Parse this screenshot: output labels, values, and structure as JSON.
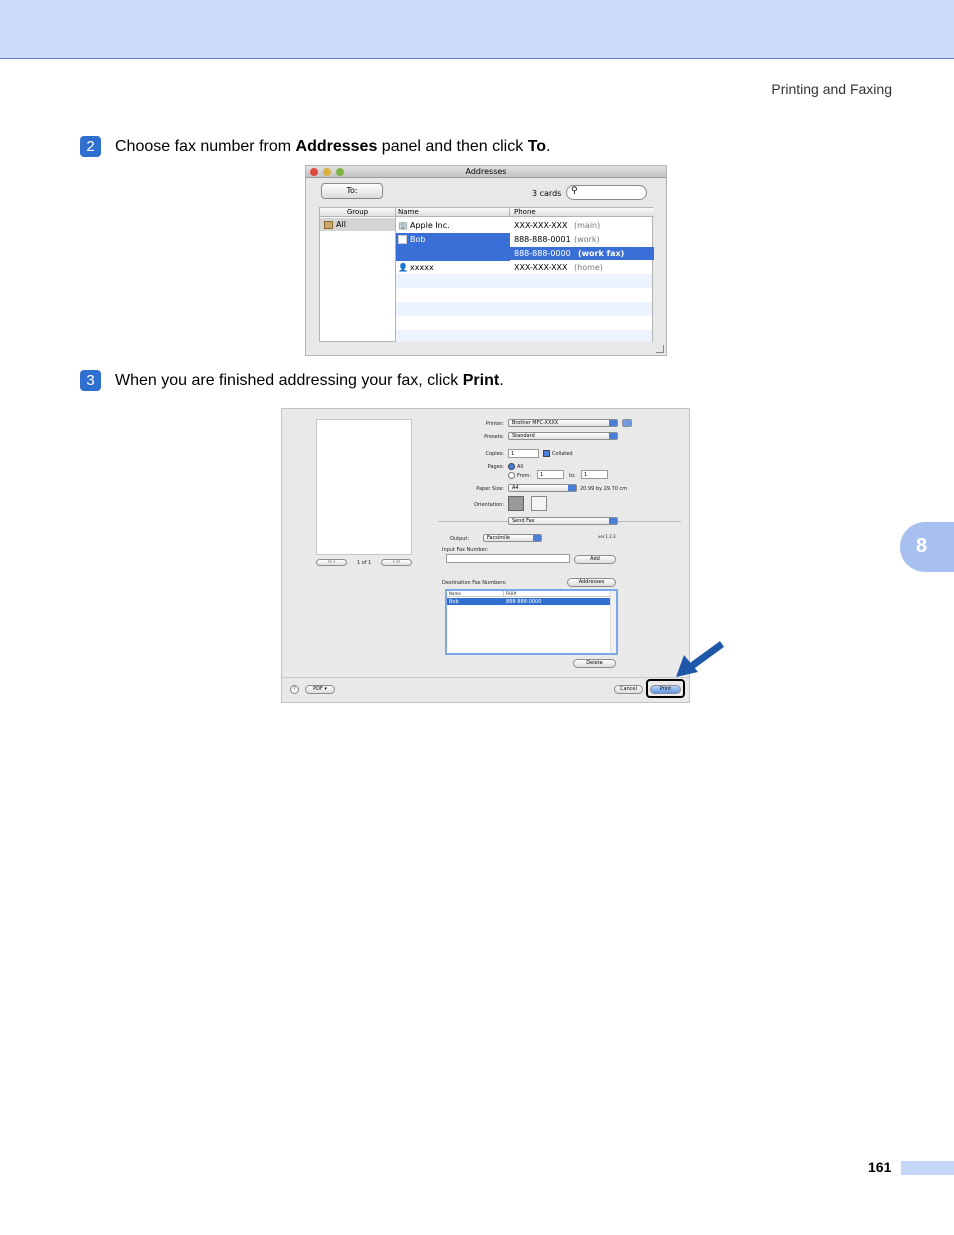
{
  "header": {
    "section_title": "Printing and Faxing"
  },
  "chapter_tab": "8",
  "steps": [
    {
      "number": "2",
      "pre": "Choose fax number from ",
      "bold1": "Addresses",
      "mid": " panel and then click ",
      "bold2": "To",
      "post": "."
    },
    {
      "number": "3",
      "pre": "When you are finished addressing your fax, click ",
      "bold1": "Print",
      "post": "."
    }
  ],
  "addresses_window": {
    "title": "Addresses",
    "to_button": "To:",
    "cards_count": "3 cards",
    "search_placeholder": "",
    "columns": {
      "group": "Group",
      "name": "Name",
      "phone": "Phone"
    },
    "groups": [
      "All"
    ],
    "entries": [
      {
        "name": "Apple Inc.",
        "phone": "XXX-XXX-XXX",
        "type": "(main)"
      },
      {
        "name": "Bob",
        "phone": "888-888-0001",
        "type": "(work)"
      },
      {
        "name": "",
        "phone": "888-888-0000",
        "type": "(work fax)"
      },
      {
        "name": "xxxxx",
        "phone": "XXX-XXX-XXX",
        "type": "(home)"
      }
    ]
  },
  "print_dialog": {
    "printer_label": "Printer:",
    "printer_value": "Brother MFC-XXXX",
    "presets_label": "Presets:",
    "presets_value": "Standard",
    "copies_label": "Copies:",
    "copies_value": "1",
    "collated": "Collated",
    "pages_label": "Pages:",
    "pages_all": "All",
    "pages_from": "From:",
    "from_value": "1",
    "pages_to": "to:",
    "to_value": "1",
    "paper_label": "Paper Size:",
    "paper_value": "A4",
    "paper_dims": "20.99 by 29.70 cm",
    "orientation_label": "Orientation:",
    "panel_value": "Send Fax",
    "output_label": "Output:",
    "output_value": "Facsimile",
    "version": "ver.1.2.3",
    "input_fax_label": "Input Fax Number:",
    "add_button": "Add",
    "dest_label": "Destination Fax Numbers:",
    "addresses_button": "Addresses",
    "dest_columns": {
      "name": "Name",
      "fax": "FAX#"
    },
    "dest_rows": [
      {
        "name": "Bob",
        "fax": "888-888-0000"
      }
    ],
    "delete_button": "Delete",
    "page_counter": "1 of 1",
    "help_icon": "?",
    "pdf_button": "PDF ▾",
    "cancel_button": "Cancel",
    "print_button": "Print"
  },
  "footer": {
    "page_number": "161"
  }
}
